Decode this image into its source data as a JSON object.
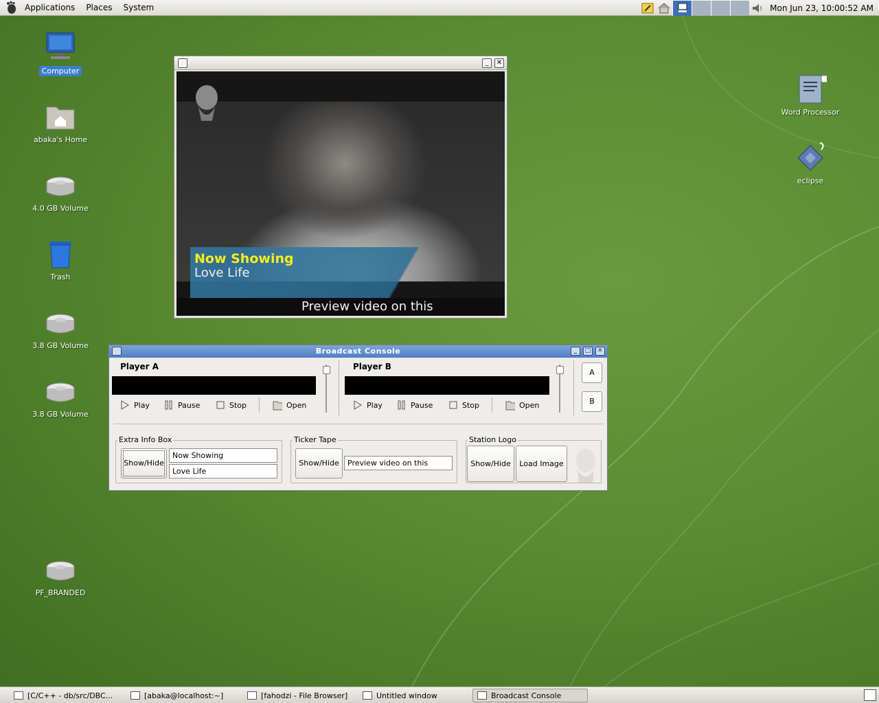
{
  "top_panel": {
    "menus": [
      "Applications",
      "Places",
      "System"
    ],
    "clock": "Mon Jun 23, 10:00:52 AM"
  },
  "desktop": {
    "left_icons": [
      {
        "label": "Computer",
        "icon": "computer-icon",
        "selected": true
      },
      {
        "label": "abaka's Home",
        "icon": "home-folder-icon"
      },
      {
        "label": "4.0 GB Volume",
        "icon": "drive-icon"
      },
      {
        "label": "Trash",
        "icon": "trash-icon"
      },
      {
        "label": "3.8 GB Volume",
        "icon": "drive-icon"
      },
      {
        "label": "3.8 GB Volume",
        "icon": "drive-icon"
      },
      {
        "label": "PF_BRANDED",
        "icon": "drive-icon"
      }
    ],
    "right_icons": [
      {
        "label": "Word Processor",
        "icon": "word-processor-icon"
      },
      {
        "label": "eclipse",
        "icon": "eclipse-icon"
      }
    ]
  },
  "video_window": {
    "overlay_title": "Now Showing",
    "overlay_subtitle": "Love Life",
    "ticker": "Preview video on this"
  },
  "console": {
    "title": "Broadcast Console",
    "player_a": {
      "label": "Player A",
      "controls": {
        "play": "Play",
        "pause": "Pause",
        "stop": "Stop",
        "open": "Open"
      }
    },
    "player_b": {
      "label": "Player B",
      "controls": {
        "play": "Play",
        "pause": "Pause",
        "stop": "Stop",
        "open": "Open"
      }
    },
    "switch": {
      "a": "A",
      "b": "B"
    },
    "extra_info": {
      "label": "Extra Info Box",
      "toggle": "Show/Hide",
      "line1": "Now Showing",
      "line2": "Love Life"
    },
    "ticker_tape": {
      "label": "Ticker Tape",
      "toggle": "Show/Hide",
      "text": "Preview video on this"
    },
    "station_logo": {
      "label": "Station Logo",
      "toggle": "Show/Hide",
      "load": "Load Image"
    }
  },
  "taskbar": [
    {
      "label": "[C/C++ - db/src/DBC...",
      "active": false
    },
    {
      "label": "[abaka@localhost:~]",
      "active": false
    },
    {
      "label": "[fahodzi - File Browser]",
      "active": false
    },
    {
      "label": "Untitled window",
      "active": false
    },
    {
      "label": "Broadcast Console",
      "active": true
    }
  ],
  "colors": {
    "desktop_green": "#5a8a32",
    "titlebar_blue": "#4f7fc4",
    "overlay_yellow": "#f5ee1a",
    "overlay_band": "#347aa5"
  }
}
